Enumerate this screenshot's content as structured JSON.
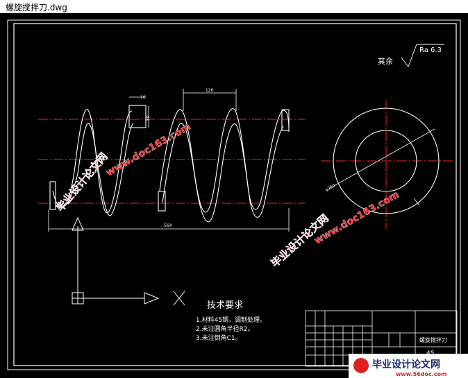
{
  "window": {
    "title": "螺旋搅拌刀.dwg"
  },
  "drawing": {
    "surface_finish": {
      "prefix": "其余",
      "value": "Ra 6.3"
    },
    "dimensions": {
      "d10": "10",
      "d50": "50",
      "d120": "120",
      "d564": "564",
      "dia": "φ250"
    },
    "tech_requirements": {
      "heading": "技术要求",
      "items": [
        "1.材料45钢，调制处理。",
        "2.未注圆角半径R2。",
        "3.未注倒角C1。"
      ]
    },
    "title_block": {
      "part_name": "螺旋搅拌刀",
      "material": "45"
    }
  },
  "watermarks": {
    "site_text": "毕业设计论文网",
    "url_text": "www.doc163.com",
    "logo_text": "毕业设计论文网",
    "logo_url": "www.56doc.com"
  },
  "colors": {
    "background": "#000000",
    "line": "#ffffff",
    "center_line": "#ff2020",
    "watermark_red": "#ff3333"
  }
}
